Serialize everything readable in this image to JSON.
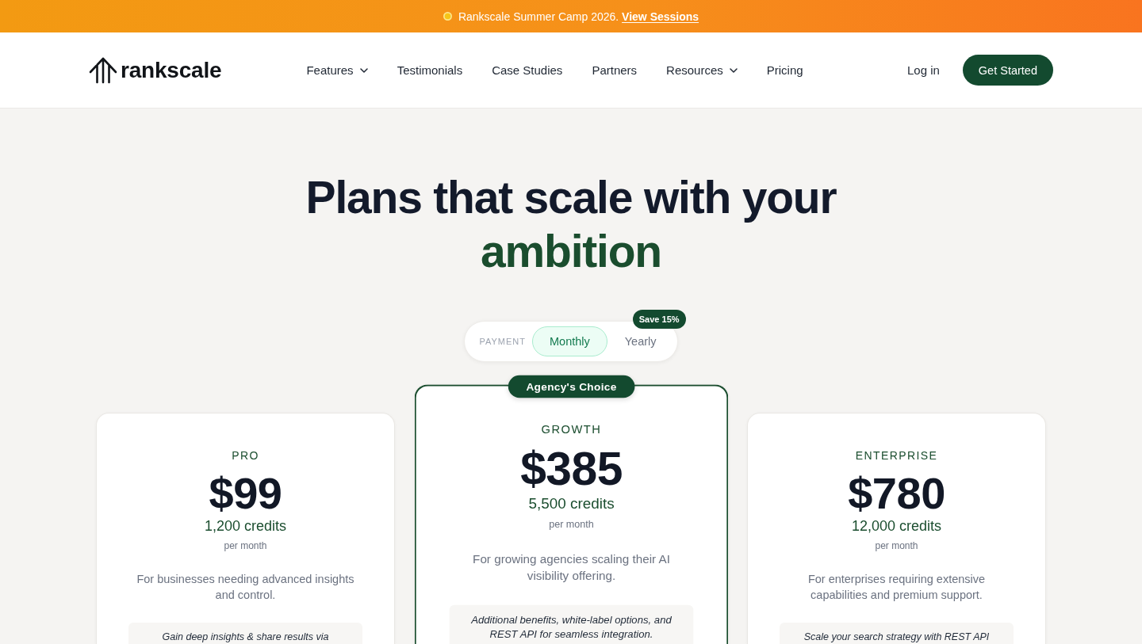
{
  "banner": {
    "text": "Rankscale Summer Camp 2026.",
    "link": "View Sessions"
  },
  "header": {
    "logo": "rankscale",
    "nav": [
      {
        "label": "Features",
        "has_menu": true
      },
      {
        "label": "Testimonials",
        "has_menu": false
      },
      {
        "label": "Case Studies",
        "has_menu": false
      },
      {
        "label": "Partners",
        "has_menu": false
      },
      {
        "label": "Resources",
        "has_menu": true
      },
      {
        "label": "Pricing",
        "has_menu": false
      }
    ],
    "login": "Log in",
    "cta": "Get Started"
  },
  "hero": {
    "title": "Plans that scale with your",
    "highlight": "ambition"
  },
  "billing": {
    "label": "PAYMENT",
    "options": [
      {
        "label": "Monthly",
        "selected": true
      },
      {
        "label": "Yearly",
        "selected": false
      }
    ],
    "badge": "Save 15%"
  },
  "plans": [
    {
      "name": "PRO",
      "price": "$99",
      "credits": "1,200 credits",
      "period": "per month",
      "description": "For businesses needing advanced insights and control.",
      "note": "Gain deep insights & share results via",
      "featured": false
    },
    {
      "badge": "Agency's Choice",
      "name": "GROWTH",
      "price": "$385",
      "credits": "5,500 credits",
      "period": "per month",
      "description": "For growing agencies scaling their AI visibility offering.",
      "note": "Additional benefits, white-label options, and REST API for seamless integration.",
      "featured": true
    },
    {
      "name": "ENTERPRISE",
      "price": "$780",
      "credits": "12,000 credits",
      "period": "per month",
      "description": "For enterprises requiring extensive capabilities and premium support.",
      "note": "Scale your search strategy with REST API",
      "featured": false
    }
  ]
}
